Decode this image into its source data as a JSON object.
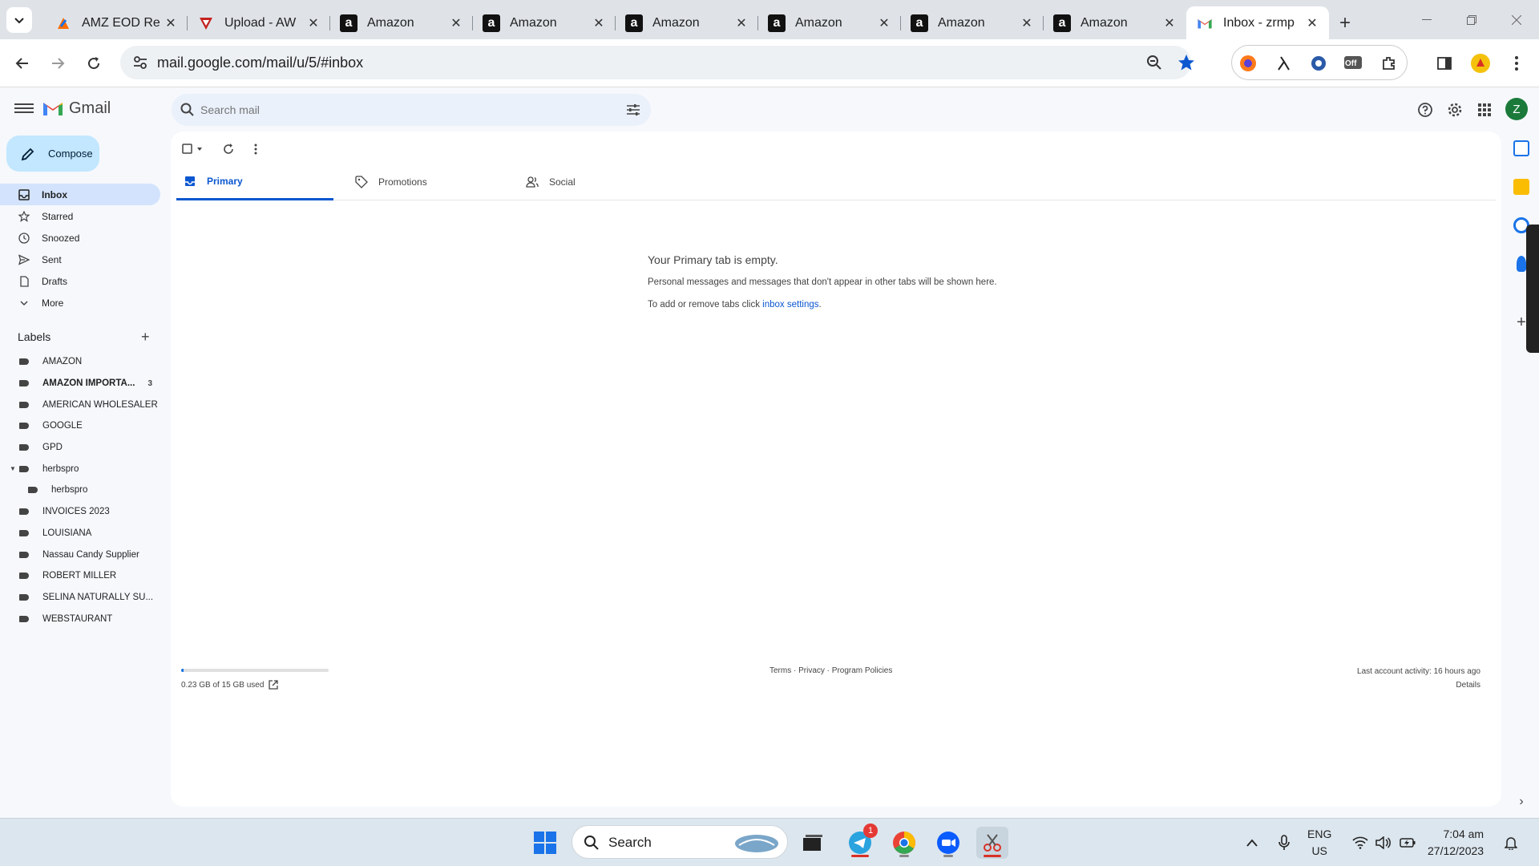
{
  "browser": {
    "tabs": [
      {
        "title": "AMZ EOD Re",
        "favicon": "docs-icon",
        "active": false
      },
      {
        "title": "Upload - AW",
        "favicon": "upload-icon",
        "active": false
      },
      {
        "title": "Amazon",
        "favicon": "amazon-icon",
        "active": false
      },
      {
        "title": "Amazon",
        "favicon": "amazon-icon",
        "active": false
      },
      {
        "title": "Amazon",
        "favicon": "amazon-icon",
        "active": false
      },
      {
        "title": "Amazon",
        "favicon": "amazon-icon",
        "active": false
      },
      {
        "title": "Amazon",
        "favicon": "amazon-icon",
        "active": false
      },
      {
        "title": "Amazon",
        "favicon": "amazon-icon",
        "active": false
      },
      {
        "title": "Inbox - zrmp",
        "favicon": "gmail-icon",
        "active": true
      }
    ],
    "url": "mail.google.com/mail/u/5/#inbox",
    "ext_badge": "Off"
  },
  "gmail": {
    "app_name": "Gmail",
    "search_placeholder": "Search mail",
    "avatar_letter": "Z",
    "compose_label": "Compose",
    "nav": [
      {
        "label": "Inbox",
        "icon": "inbox-icon",
        "active": true
      },
      {
        "label": "Starred",
        "icon": "star-icon",
        "active": false
      },
      {
        "label": "Snoozed",
        "icon": "clock-icon",
        "active": false
      },
      {
        "label": "Sent",
        "icon": "send-icon",
        "active": false
      },
      {
        "label": "Drafts",
        "icon": "draft-icon",
        "active": false
      },
      {
        "label": "More",
        "icon": "chevron-down-icon",
        "active": false
      }
    ],
    "labels_title": "Labels",
    "labels": [
      {
        "name": "AMAZON"
      },
      {
        "name": "AMAZON IMPORTA...",
        "count": "3",
        "bold": true
      },
      {
        "name": "AMERICAN WHOLESALER"
      },
      {
        "name": "GOOGLE"
      },
      {
        "name": "GPD"
      },
      {
        "name": "herbspro",
        "expanded": true
      },
      {
        "name": "herbspro",
        "sub": true
      },
      {
        "name": "INVOICES 2023"
      },
      {
        "name": "LOUISIANA"
      },
      {
        "name": "Nassau Candy Supplier"
      },
      {
        "name": "ROBERT MILLER"
      },
      {
        "name": "SELINA NATURALLY SU..."
      },
      {
        "name": "WEBSTAURANT"
      }
    ],
    "tabs": [
      {
        "label": "Primary",
        "icon": "inbox-icon",
        "active": true
      },
      {
        "label": "Promotions",
        "icon": "tag-icon",
        "active": false
      },
      {
        "label": "Social",
        "icon": "people-icon",
        "active": false
      }
    ],
    "empty": {
      "title": "Your Primary tab is empty.",
      "line1": "Personal messages and messages that don't appear in other tabs will be shown here.",
      "line2_prefix": "To add or remove tabs click ",
      "line2_link": "inbox settings",
      "line2_suffix": "."
    },
    "footer": {
      "storage_text": "0.23 GB of 15 GB used",
      "storage_fraction": 0.015,
      "links": "Terms · Privacy · Program Policies",
      "activity": "Last account activity: 16 hours ago",
      "details": "Details"
    }
  },
  "taskbar": {
    "search_label": "Search",
    "telegram_badge": "1",
    "lang_top": "ENG",
    "lang_bottom": "US",
    "time": "7:04 am",
    "date": "27/12/2023"
  },
  "colors": {
    "accent": "#0b57d0",
    "compose_bg": "#c2e7ff",
    "inbox_active_bg": "#d3e3fd",
    "avatar": "#1b7a3a"
  }
}
